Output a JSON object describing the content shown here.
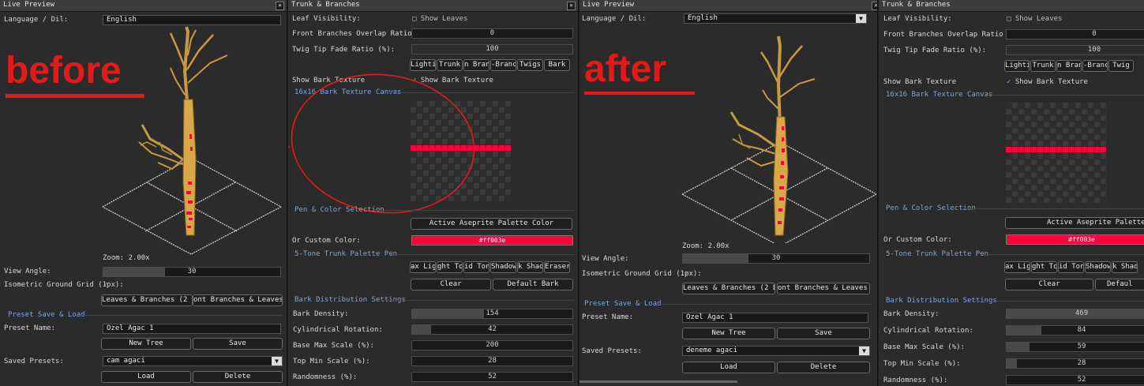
{
  "annotations": {
    "before": "before",
    "after": "after"
  },
  "colors": {
    "accent": "#7ea6e0",
    "bark_red": "#ff003e",
    "annotation": "#e61919"
  },
  "live_preview": {
    "title": "Live Preview",
    "language_label": "Language / Dil:",
    "language_value": "English",
    "zoom": "Zoom: 2.00x",
    "view_angle_label": "View Angle:",
    "view_angle_value": "30",
    "iso_grid_label": "Isometric Ground Grid (1px):",
    "tab_left": "Leaves & Branches (2 Lay",
    "tab_right": "ont Branches & Leaves (2",
    "preset_section": "Preset Save & Load",
    "preset_name_label": "Preset Name:",
    "preset_name_value": "Ozel Agac 1",
    "new_tree": "New Tree",
    "save": "Save",
    "saved_presets_label": "Saved Presets:",
    "load": "Load",
    "delete": "Delete"
  },
  "before_preview": {
    "saved_preset_value": "cam agaci"
  },
  "after_preview": {
    "saved_preset_value": "deneme agaci"
  },
  "trunk": {
    "title": "Trunk & Branches",
    "leaf_visibility_label": "Leaf Visibility:",
    "show_leaves": "Show Leaves",
    "front_overlap_label": "Front Branches Overlap Ratio (%):",
    "front_overlap_value": "0",
    "twig_fade_label": "Twig Tip Fade Ratio (%):",
    "twig_fade_value": "100",
    "show_bark_label": "Show Bark Texture",
    "show_bark_check": "Show Bark Texture",
    "canvas_section": "16x16 Bark Texture Canvas",
    "pen_section": "Pen & Color Selection",
    "active_palette": "Active Aseprite Palette Color",
    "custom_color_label": "Or Custom Color:",
    "custom_color_value": "#ff003e",
    "five_tone_section": "5-Tone Trunk Palette Pen",
    "clear": "Clear",
    "default_bark": "Default Bark",
    "dist_section": "Bark Distribution Settings",
    "bark_density_label": "Bark Density:",
    "cyl_rot_label": "Cylindrical Rotation:",
    "base_max_label": "Base Max Scale (%):",
    "top_min_label": "Top Min Scale (%):",
    "randomness_label": "Randomness (%):"
  },
  "before_trunk": {
    "mode_tabs": [
      "Lighting",
      "Trunk",
      "n Branc",
      "-Branc",
      "Twigs",
      "Bark"
    ],
    "tone_tabs": [
      "ax Lig",
      "ght To",
      "id Ton",
      "Shadow",
      "k Shad",
      "Eraser"
    ],
    "bark_density": 154,
    "bark_density_frac": 0.45,
    "cyl_rot": 42,
    "cyl_rot_frac": 0.12,
    "base_max": 200,
    "base_max_frac": 0.0,
    "top_min": 28,
    "top_min_frac": 0.0,
    "randomness": 52,
    "randomness_frac": 0.0
  },
  "after_trunk": {
    "mode_tabs": [
      "Lighting",
      "Trunk",
      "n Branc",
      "-Branch",
      "Twig"
    ],
    "tone_tabs": [
      "ax Ligh",
      "ght Ton",
      "id Tone",
      "Shadow",
      "k Shad"
    ],
    "default_bark_clip": "Defaul",
    "bark_density": 469,
    "bark_density_frac": 0.95,
    "cyl_rot": 84,
    "cyl_rot_frac": 0.23,
    "base_max": 59,
    "base_max_frac": 0.15,
    "top_min": 28,
    "top_min_frac": 0.07,
    "randomness": 52,
    "randomness_frac": 0.0
  }
}
